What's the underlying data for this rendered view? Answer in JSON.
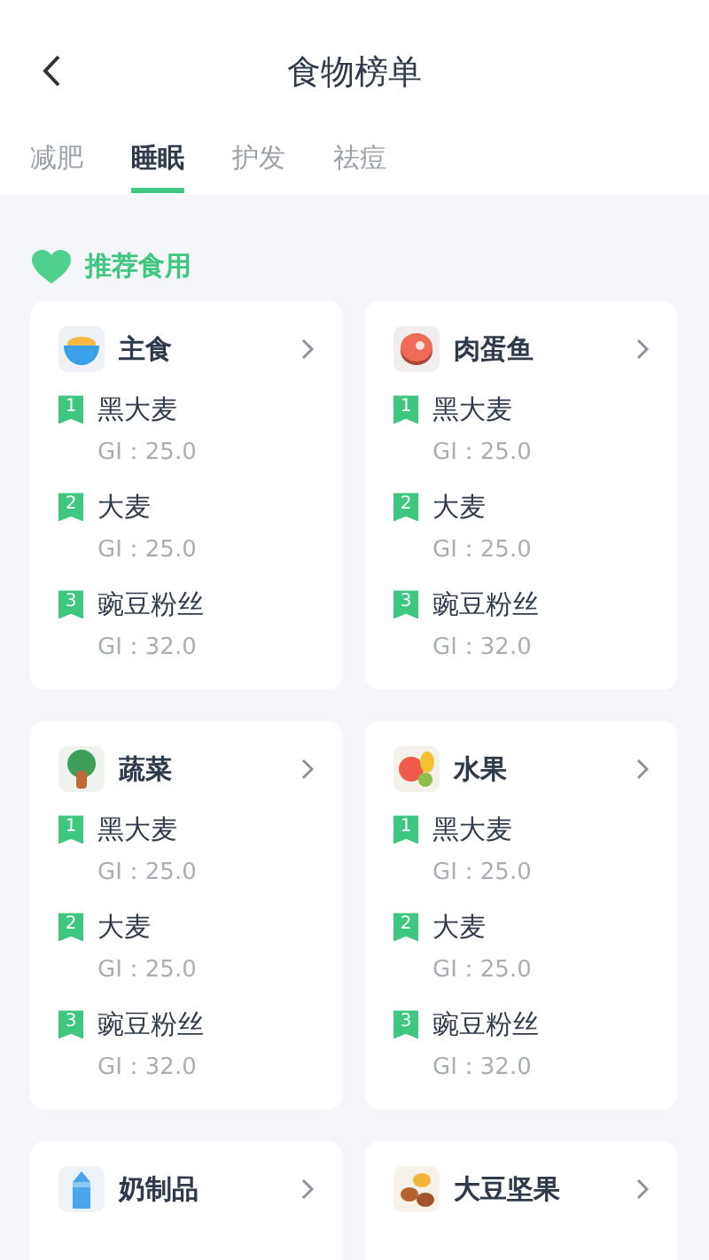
{
  "header": {
    "title": "食物榜单"
  },
  "tabs": [
    {
      "label": "减肥",
      "selected": false
    },
    {
      "label": "睡眠",
      "selected": true
    },
    {
      "label": "护发",
      "selected": false
    },
    {
      "label": "祛痘",
      "selected": false
    }
  ],
  "section": {
    "title": "推荐食用"
  },
  "categories": [
    {
      "name": "主食",
      "kind": "staple",
      "foods": [
        {
          "rank": "1",
          "name": "黑大麦",
          "gi": "GI：25.0"
        },
        {
          "rank": "2",
          "name": "大麦",
          "gi": "GI：25.0"
        },
        {
          "rank": "3",
          "name": "豌豆粉丝",
          "gi": "GI：32.0"
        }
      ]
    },
    {
      "name": "肉蛋鱼",
      "kind": "meat",
      "foods": [
        {
          "rank": "1",
          "name": "黑大麦",
          "gi": "GI：25.0"
        },
        {
          "rank": "2",
          "name": "大麦",
          "gi": "GI：25.0"
        },
        {
          "rank": "3",
          "name": "豌豆粉丝",
          "gi": "GI：32.0"
        }
      ]
    },
    {
      "name": "蔬菜",
      "kind": "vegetable",
      "foods": [
        {
          "rank": "1",
          "name": "黑大麦",
          "gi": "GI：25.0"
        },
        {
          "rank": "2",
          "name": "大麦",
          "gi": "GI：25.0"
        },
        {
          "rank": "3",
          "name": "豌豆粉丝",
          "gi": "GI：32.0"
        }
      ]
    },
    {
      "name": "水果",
      "kind": "fruit",
      "foods": [
        {
          "rank": "1",
          "name": "黑大麦",
          "gi": "GI：25.0"
        },
        {
          "rank": "2",
          "name": "大麦",
          "gi": "GI：25.0"
        },
        {
          "rank": "3",
          "name": "豌豆粉丝",
          "gi": "GI：32.0"
        }
      ]
    },
    {
      "name": "奶制品",
      "kind": "dairy"
    },
    {
      "name": "大豆坚果",
      "kind": "nuts"
    }
  ]
}
